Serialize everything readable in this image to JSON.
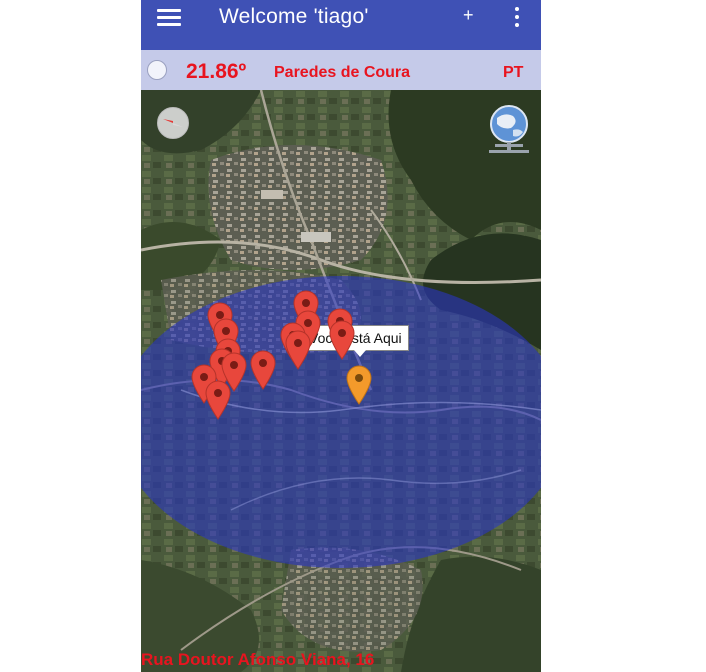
{
  "appbar": {
    "title": "Welcome 'tiago'",
    "add_label": "+",
    "menu_icon": "hamburger-menu-icon",
    "overflow_icon": "more-vert-icon",
    "color": "#3f51b5"
  },
  "status": {
    "temperature": "21.86º",
    "city": "Paredes de Coura",
    "language": "PT",
    "text_color": "#e8141f",
    "background": "#c5cae9"
  },
  "map": {
    "type": "satellite",
    "user_location_label": "Você está Aqui",
    "radius_color": "#2a36c8",
    "marker_colors": {
      "poi": "#e8473c",
      "user": "#f39a2b"
    },
    "poi_marker_count": 14,
    "compass_icon": "compass-icon",
    "globe_icon": "globe-layers-icon"
  },
  "footer": {
    "address": "Rua Doutor Afonso Viana, 16"
  }
}
